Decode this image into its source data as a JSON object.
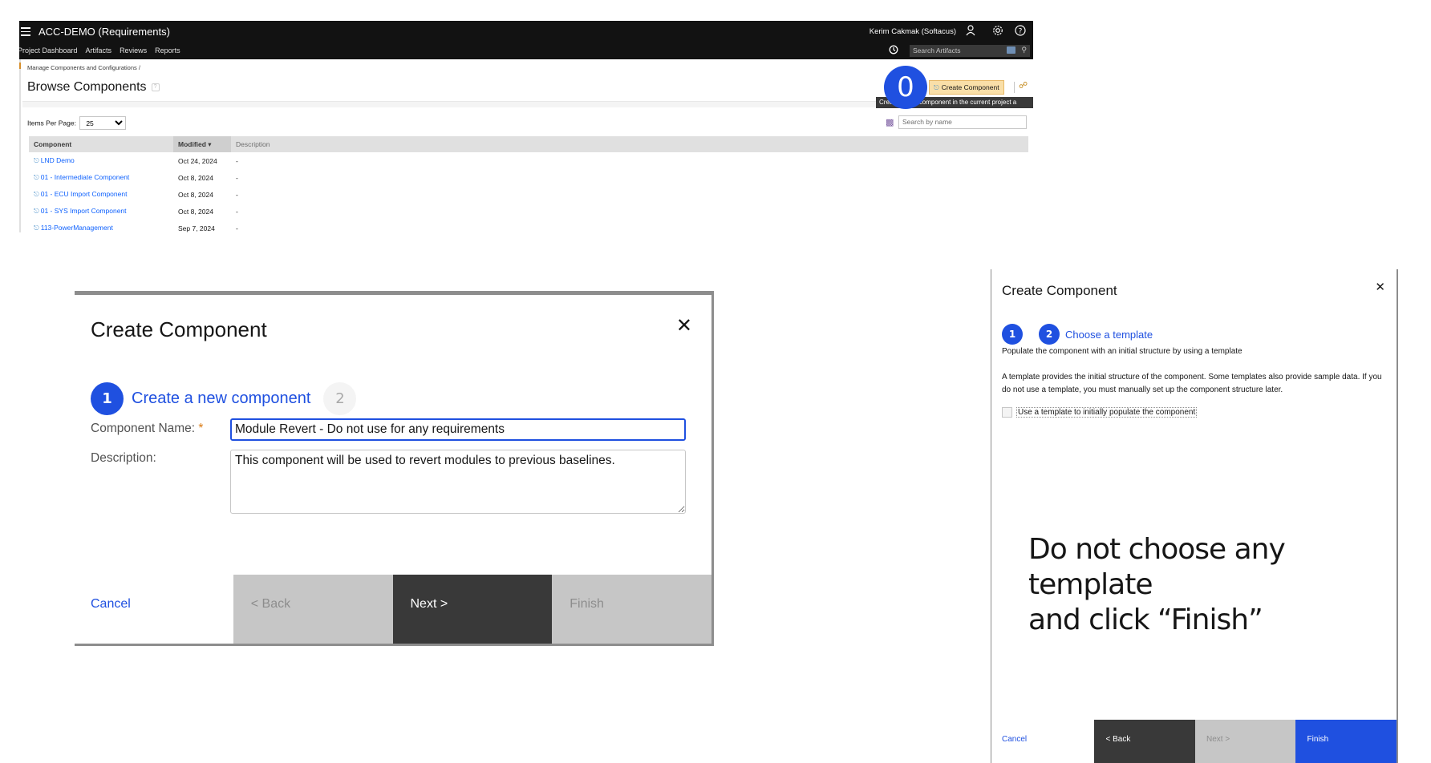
{
  "top_screenshot": {
    "app_title": "ACC-DEMO (Requirements)",
    "user_name": "Kerim Cakmak (Softacus)",
    "nav": [
      "Project Dashboard",
      "Artifacts",
      "Reviews",
      "Reports"
    ],
    "search_artifacts_placeholder": "Search Artifacts",
    "breadcrumb": "Manage Components and Configurations /",
    "page_title": "Browse Components",
    "help_glyph": "?",
    "step_marker": "0",
    "create_component_label": "Create Component",
    "tooltip": "Create a new component in the current project a",
    "search_by_name_placeholder": "Search by name",
    "items_per_page_label": "Items Per Page:",
    "items_per_page_value": "25",
    "table": {
      "columns": [
        "Component",
        "Modified ▾",
        "Description"
      ],
      "rows": [
        {
          "component": "LND Demo",
          "modified": "Oct 24, 2024",
          "description": "-"
        },
        {
          "component": "01 - Intermediate Component",
          "modified": "Oct 8, 2024",
          "description": "-"
        },
        {
          "component": "01 - ECU Import Component",
          "modified": "Oct 8, 2024",
          "description": "-"
        },
        {
          "component": "01 - SYS Import Component",
          "modified": "Oct 8, 2024",
          "description": "-"
        },
        {
          "component": "113-PowerManagement",
          "modified": "Sep 7, 2024",
          "description": "-"
        }
      ]
    }
  },
  "dialog_step1": {
    "title": "Create Component",
    "close_glyph": "✕",
    "steps": [
      {
        "number": "1",
        "label": "Create a new component",
        "active": true
      },
      {
        "number": "2",
        "label": "",
        "active": false
      }
    ],
    "component_name_label": "Component Name:",
    "required_marker": "*",
    "component_name_value": "Module Revert - Do not use for any requirements",
    "description_label": "Description:",
    "description_value": "This component will be used to revert modules to previous baselines.",
    "buttons": {
      "cancel": "Cancel",
      "back": "< Back",
      "next": "Next >",
      "finish": "Finish"
    }
  },
  "dialog_step2": {
    "title": "Create Component",
    "close_glyph": "✕",
    "steps": [
      {
        "number": "1",
        "active": true
      },
      {
        "number": "2",
        "label": "Choose a template",
        "active": true
      }
    ],
    "subtitle": "Populate the component with an initial structure by using a template",
    "paragraph": "A template provides the initial structure of the component. Some templates also provide sample data. If you do not use a template, you must manually set up the component structure later.",
    "checkbox_label": "Use a template to initially populate the component",
    "checkbox_checked": false,
    "instruction_line1": "Do not choose any template",
    "instruction_line2": "and click “Finish”",
    "buttons": {
      "cancel": "Cancel",
      "back": "< Back",
      "next": "Next >",
      "finish": "Finish"
    }
  },
  "colors": {
    "accent": "#1f50e0",
    "create_button": "#f9dfa8",
    "dark_button": "#393939",
    "disabled_button": "#c6c6c6"
  }
}
